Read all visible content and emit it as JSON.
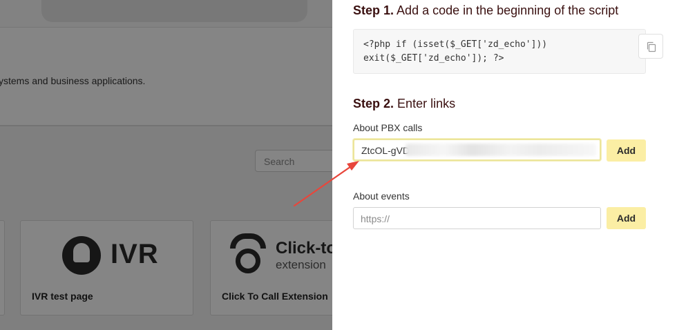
{
  "background": {
    "description_text": "ystems and business applications.",
    "search_placeholder": "Search",
    "cards": [
      {
        "title": "IVR test page",
        "logo_text": "IVR"
      },
      {
        "title": "Click To Call Extension",
        "logo_title": "Click-to",
        "logo_subtitle": "extension"
      }
    ]
  },
  "drawer": {
    "step1": {
      "number": "Step 1.",
      "text": "Add a code in the beginning of the script"
    },
    "code": {
      "line1": "<?php if (isset($_GET['zd_echo']))",
      "line2": "exit($_GET['zd_echo']); ?>",
      "copy_icon": "copy-icon"
    },
    "step2": {
      "number": "Step 2.",
      "text": "Enter links"
    },
    "pbx": {
      "label": "About PBX calls",
      "value": "ZtcOL-gVD",
      "add_label": "Add"
    },
    "events": {
      "label": "About events",
      "placeholder": "https://",
      "add_label": "Add"
    }
  },
  "colors": {
    "accent_button": "#fbeea4",
    "focus_border": "#ece59a",
    "heading": "#3a1010",
    "arrow": "#e8463b"
  }
}
